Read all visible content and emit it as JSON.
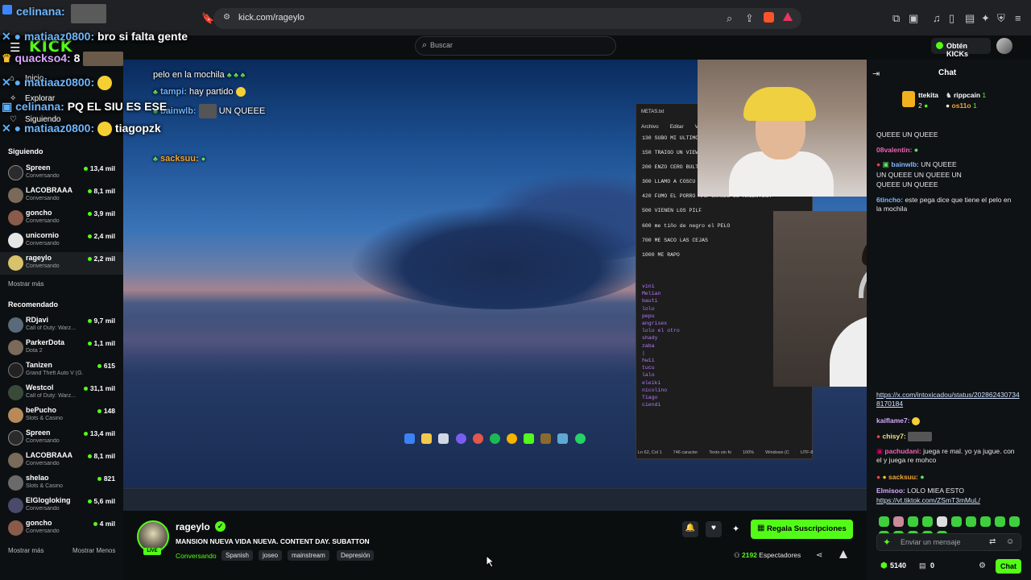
{
  "browser": {
    "url": "kick.com/rageylo",
    "tab_user": "celinana:"
  },
  "header": {
    "logo": "KICK",
    "search_placeholder": "Buscar",
    "kicks_button": "Obtén KICKs"
  },
  "sidebar": {
    "nav": [
      "Inicio",
      "Explorar",
      "Siguiendo"
    ],
    "following_title": "Siguiendo",
    "following": [
      {
        "name": "Spreen",
        "category": "Conversando",
        "viewers": "13,4 mil"
      },
      {
        "name": "LACOBRAAA",
        "category": "Conversando",
        "viewers": "8,1 mil"
      },
      {
        "name": "goncho",
        "category": "Conversando",
        "viewers": "3,9 mil"
      },
      {
        "name": "unicornio",
        "category": "Conversando",
        "viewers": "2,4 mil"
      },
      {
        "name": "rageylo",
        "category": "Conversando",
        "viewers": "2,2 mil"
      }
    ],
    "show_more": "Mostrar más",
    "recommended_title": "Recomendado",
    "recommended": [
      {
        "name": "RDjavi",
        "category": "Call of Duty: Warz...",
        "viewers": "9,7 mil"
      },
      {
        "name": "ParkerDota",
        "category": "Dota 2",
        "viewers": "1,1 mil"
      },
      {
        "name": "Tanizen",
        "category": "Grand Theft Auto V (G...",
        "viewers": "615"
      },
      {
        "name": "Westcol",
        "category": "Call of Duty: Warz...",
        "viewers": "31,1 mil"
      },
      {
        "name": "bePucho",
        "category": "Slots & Casino",
        "viewers": "148"
      },
      {
        "name": "Spreen",
        "category": "Conversando",
        "viewers": "13,4 mil"
      },
      {
        "name": "LACOBRAAA",
        "category": "Conversando",
        "viewers": "8,1 mil"
      },
      {
        "name": "shelao",
        "category": "Slots & Casino",
        "viewers": "821"
      },
      {
        "name": "ElGlogloking",
        "category": "Conversando",
        "viewers": "5,6 mil"
      },
      {
        "name": "goncho",
        "category": "Conversando",
        "viewers": "4 mil"
      }
    ],
    "show_more_2": "Mostrar más",
    "show_less": "Mostrar Menos"
  },
  "overlay_chat": [
    {
      "user": "matiaaz0800:",
      "text": "bro si falta gente"
    },
    {
      "user": "quackso4:",
      "text": "8"
    },
    {
      "user": "matiaaz0800:",
      "text": ""
    },
    {
      "user": "celinana:",
      "text": "PQ EL SIU ES ESE"
    },
    {
      "user": "matiaaz0800:",
      "text": "tiagopzk"
    }
  ],
  "stream_overlay": {
    "line1": "pelo en la mochila",
    "line2_user": "tampi:",
    "line2_text": "hay partido",
    "line3_user": "bainwlb:",
    "line3_text": "UN QUEEE",
    "line5_user": "sacksuu:"
  },
  "notepad": {
    "title": "METAS.txt",
    "menu": [
      "Archivo",
      "Editar",
      "Ver"
    ],
    "goals": [
      "130 SUBO MI ULTIMO",
      "150 TRAIGO UN VIEW",
      "200 ENZO CERO BULT",
      "300 LLAMO A COSCU",
      "420 FUMO EL PORRO MAS GRANDE DE ARGENTINA",
      "500 VIENEN LOS PILF",
      "600 me tiño de negro el PELO",
      "700 ME SACO LAS CEJAS",
      "1000 ME RAPO"
    ],
    "names": [
      "vini",
      "Melian",
      "bauti",
      "lolo",
      "pepu",
      "angrisex",
      "lolo el otro",
      "shady",
      "zaba",
      "|",
      "hwii",
      "tucu",
      "lalo",
      "eleiki",
      "nicolino",
      "Tiago",
      "ciendi"
    ],
    "status": [
      "Ln 62, Col 1",
      "746 caracter",
      "Texto sin fo",
      "100%",
      "Windows (C",
      "UTF-8"
    ]
  },
  "taskbar": {
    "lang": "ESP\nLAA",
    "time": "21:15\n2/3/2026"
  },
  "chat": {
    "title": "Chat",
    "pinned": [
      {
        "user": "ttekita",
        "n": "2"
      },
      {
        "user": "rippcain",
        "n": "1"
      },
      {
        "user": "os11o",
        "n": "1"
      }
    ],
    "messages": [
      {
        "user": "",
        "text": "QUEEE        UN QUEEE"
      },
      {
        "user": "08valentin:",
        "text": ""
      },
      {
        "user": "bainwlb:",
        "text": "UN QUEEE"
      },
      {
        "user": "",
        "text": "UN QUEEE        UN QUEEE        UN"
      },
      {
        "user": "",
        "text": "QUEEE        UN QUEEE"
      },
      {
        "user": "6tincho:",
        "text": "este pega dice que tiene el pelo en la mochila"
      }
    ],
    "messages2": [
      {
        "user": "",
        "text": "https://x.com/intoxicadou/status/2028624307348170184",
        "link": true
      },
      {
        "user": "kaiflame7:",
        "text": ""
      },
      {
        "user": "chisy7:",
        "text": ""
      },
      {
        "user": "pachudani:",
        "text": "juega re mal. yo ya jugue. con el y juega re mohco"
      },
      {
        "user": "sacksuu:",
        "text": ""
      },
      {
        "user": "Elmisoo:",
        "text": "LOLO MIEA ESTO"
      },
      {
        "user": "",
        "text": "https://vt.tiktok.com/ZSmT3mMuL/",
        "link": true
      }
    ],
    "input_placeholder": "Enviar un mensaje",
    "kicks": "5140",
    "badge": "0",
    "send_button": "Chat"
  },
  "stream_info": {
    "streamer": "rageylo",
    "live": "LIVE",
    "title": "MANSION NUEVA VIDA NUEVA. CONTENT DAY. SUBATTON",
    "category": "Conversando",
    "tags": [
      "Spanish",
      "joseo",
      "mainstream",
      "Depresión"
    ],
    "subscribe_button": "Regala Suscripciones",
    "viewers": "2192",
    "viewers_label": "Espectadores"
  }
}
